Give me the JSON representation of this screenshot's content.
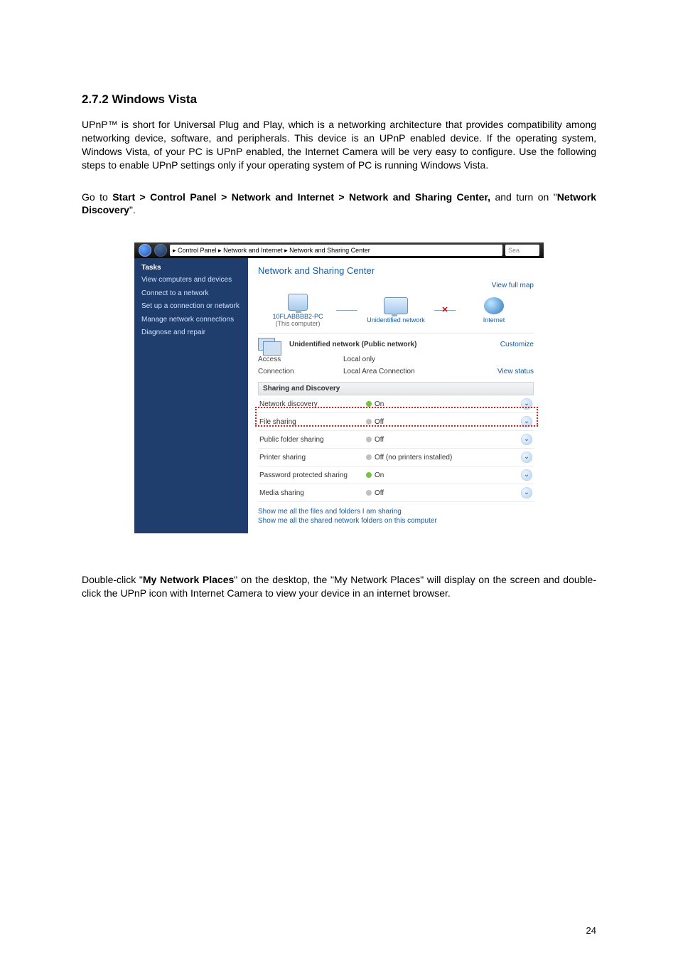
{
  "heading": "2.7.2 Windows Vista",
  "para1": "UPnP™ is short for Universal Plug and Play, which is a networking architecture that provides compatibility among networking device, software, and peripherals. This device is an UPnP enabled device. If the operating system, Windows Vista, of your PC is UPnP enabled, the Internet Camera will be very easy to configure. Use the following steps to enable UPnP settings only if your operating system of PC is running Windows Vista.",
  "para2_pre": "Go to ",
  "para2_bold": "Start > Control Panel > Network and Internet > Network and Sharing Center,",
  "para2_mid": " and turn on \"",
  "para2_bold2": "Network Discovery",
  "para2_post": "\".",
  "para3_pre": "Double-click \"",
  "para3_bold": "My Network Places",
  "para3_mid": "\" on the desktop, the \"My Network Places\" will display on the screen and double-click the UPnP icon with Internet Camera to view your device in an internet browser.",
  "page_number": "24",
  "ss": {
    "breadcrumb": "▸ Control Panel ▸ Network and Internet ▸ Network and Sharing Center",
    "search_placeholder": "Sea",
    "sidebar": {
      "header": "Tasks",
      "items": [
        "View computers and devices",
        "Connect to a network",
        "Set up a connection or network",
        "Manage network connections",
        "Diagnose and repair"
      ]
    },
    "title": "Network and Sharing Center",
    "view_full_map": "View full map",
    "nodes": {
      "pc_name": "10FLABBBB2-PC",
      "pc_sub": "(This computer)",
      "mid_name": "Unidentified network",
      "right_name": "Internet"
    },
    "unident_label": "Unidentified network (Public network)",
    "customize": "Customize",
    "access_label": "Access",
    "access_value": "Local only",
    "conn_label": "Connection",
    "conn_value": "Local Area Connection",
    "view_status": "View status",
    "sd_header": "Sharing and Discovery",
    "rows": [
      {
        "name": "Network discovery",
        "on": true,
        "value": "On"
      },
      {
        "name": "File sharing",
        "on": false,
        "value": "Off"
      },
      {
        "name": "Public folder sharing",
        "on": false,
        "value": "Off"
      },
      {
        "name": "Printer sharing",
        "on": false,
        "value": "Off (no printers installed)"
      },
      {
        "name": "Password protected sharing",
        "on": true,
        "value": "On"
      },
      {
        "name": "Media sharing",
        "on": false,
        "value": "Off"
      }
    ],
    "showme1": "Show me all the files and folders I am sharing",
    "showme2": "Show me all the shared network folders on this computer"
  }
}
